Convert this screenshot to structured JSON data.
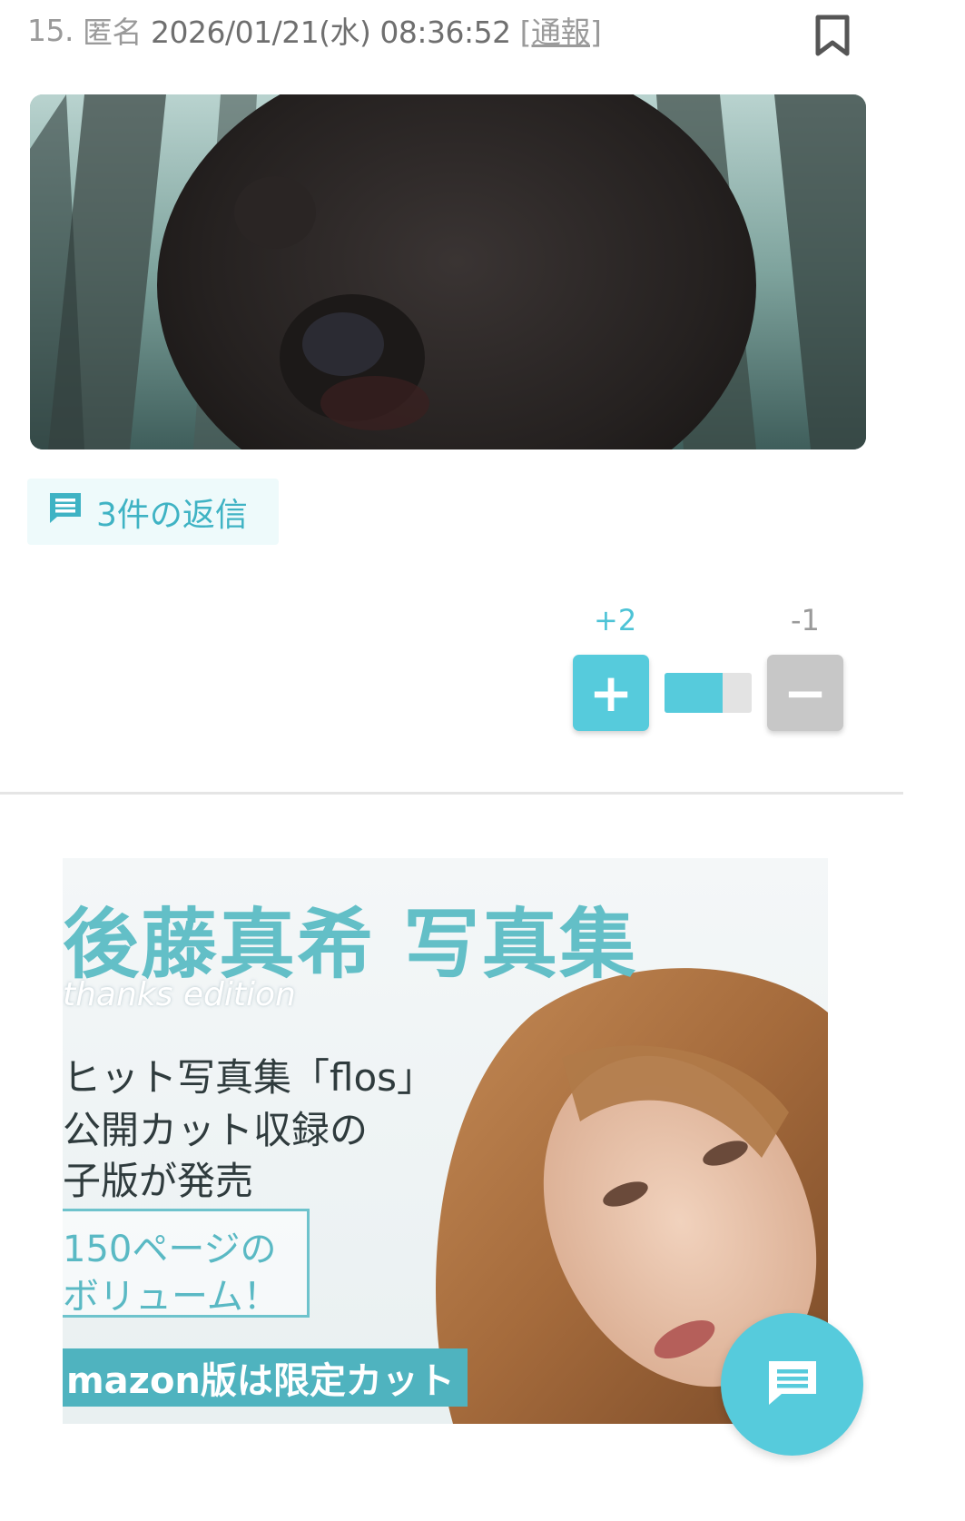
{
  "post": {
    "number": "15.",
    "author": "匿名",
    "datetime": "2026/01/21(水) 08:36:52",
    "report_label": "[通報]",
    "bookmark_icon": "bookmark-icon",
    "image_icon": "post-image"
  },
  "replies": {
    "label": "3件の返信",
    "icon": "comment-icon"
  },
  "votes": {
    "plus_count": "+2",
    "minus_count": "-1",
    "plus_symbol": "+",
    "minus_symbol": "−",
    "plus_ratio": 0.67,
    "accent_color": "#56cbdc",
    "neutral_color": "#c7c7c7"
  },
  "ad": {
    "title": "後藤真希 写真集",
    "subtitle": "thanks edition",
    "lines": [
      "ヒット写真集「flos」",
      "公開カット収録の",
      "子版が発売"
    ],
    "box_lines": [
      "150ページの",
      "ボリューム！"
    ],
    "amazon_label": "mazon版は限定カット"
  },
  "fab": {
    "icon": "chat-icon"
  }
}
